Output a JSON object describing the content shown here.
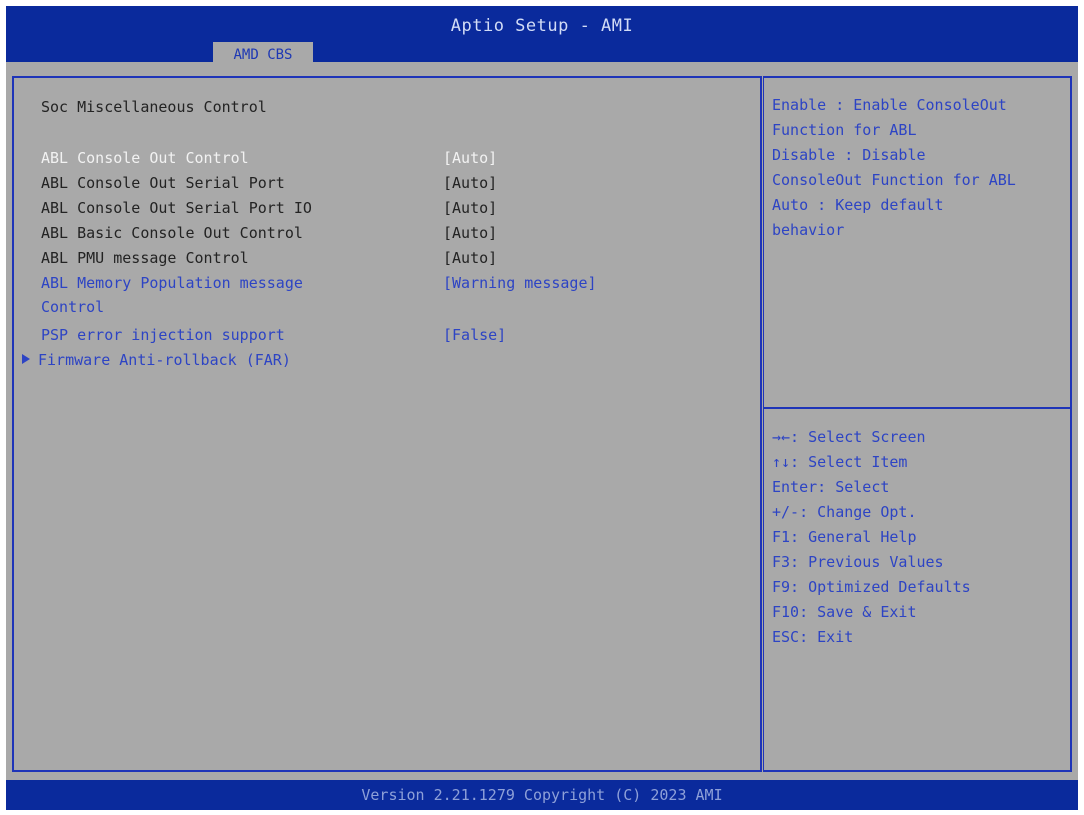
{
  "header": {
    "app_title": "Aptio Setup - AMI",
    "tabs": [
      {
        "label": "AMD CBS"
      }
    ]
  },
  "main": {
    "section_title": "Soc Miscellaneous Control",
    "items": [
      {
        "label": "ABL Console Out Control",
        "value": "[Auto]"
      },
      {
        "label": "ABL Console Out Serial Port",
        "value": "[Auto]"
      },
      {
        "label": "ABL Console Out Serial Port IO",
        "value": "[Auto]"
      },
      {
        "label": "ABL Basic Console Out Control",
        "value": "[Auto]"
      },
      {
        "label": "ABL PMU message Control",
        "value": "[Auto]"
      },
      {
        "label_line1": "ABL Memory Population message",
        "label_line2": "Control",
        "value": "[Warning message]"
      },
      {
        "label": "PSP error injection support",
        "value": "[False]"
      }
    ],
    "submenu": {
      "label": "Firmware Anti-rollback (FAR)"
    }
  },
  "help": {
    "lines": [
      "Enable : Enable ConsoleOut",
      "Function for ABL",
      "Disable : Disable",
      "ConsoleOut Function for ABL",
      "Auto : Keep default",
      "behavior"
    ]
  },
  "keys": [
    "→←: Select Screen",
    "↑↓: Select Item",
    "Enter: Select",
    "+/-: Change Opt.",
    "F1: General Help",
    "F3: Previous Values",
    "F9: Optimized Defaults",
    "F10: Save & Exit",
    "ESC: Exit"
  ],
  "footer": {
    "version": "Version 2.21.1279 Copyright (C) 2023 AMI"
  }
}
